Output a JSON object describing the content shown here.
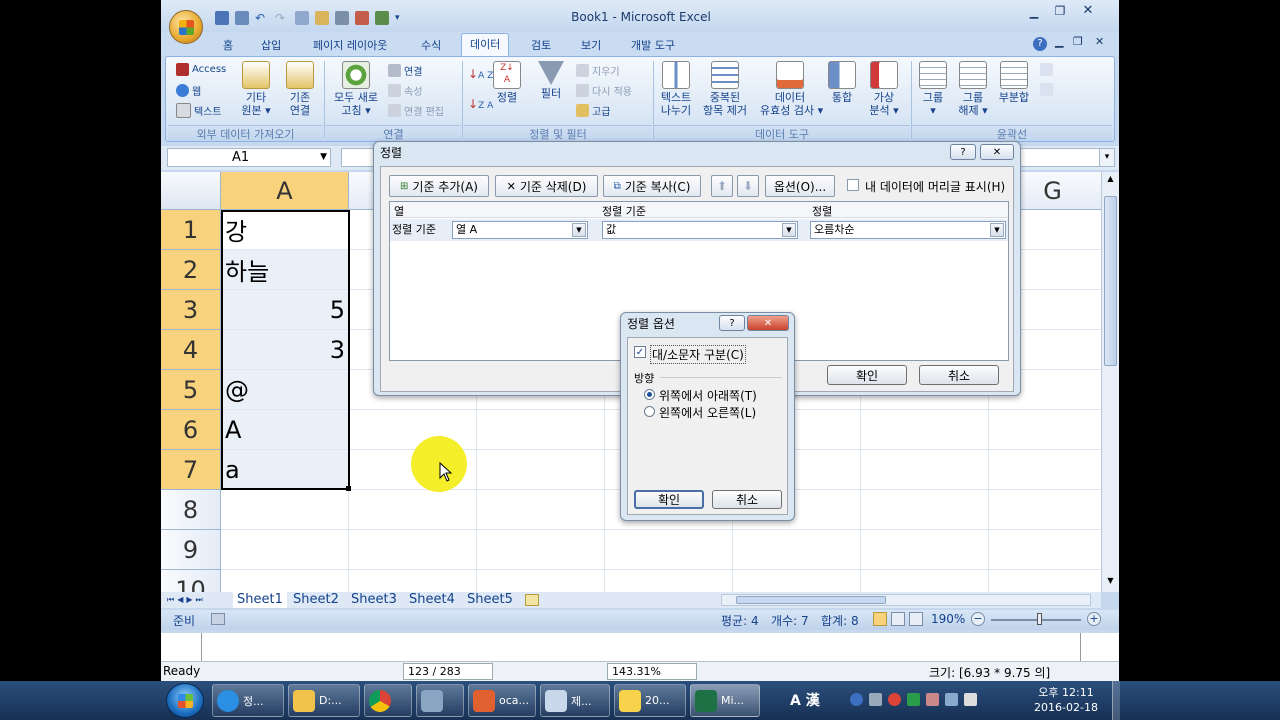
{
  "excel": {
    "title": "Book1 - Microsoft Excel",
    "tabs": [
      "홈",
      "삽입",
      "페이지 레이아웃",
      "수식",
      "데이터",
      "검토",
      "보기",
      "개발 도구"
    ],
    "active_tab": "데이터",
    "ribbon": {
      "external": {
        "access": "Access",
        "web": "웹",
        "text": "텍스트",
        "other": "기타\n원본 ▾",
        "existing": "기존\n연결",
        "group": "외부 데이터 가져오기"
      },
      "connections": {
        "refresh_all": "모두 새로\n고침 ▾",
        "connections": "연결",
        "properties": "속성",
        "edit_links": "연결 편집",
        "group": "연결"
      },
      "sort_filter": {
        "sort": "정렬",
        "filter": "필터",
        "clear": "지우기",
        "reapply": "다시 적용",
        "advanced": "고급",
        "group": "정렬 및 필터"
      },
      "data_tools": {
        "text_to_columns": "텍스트\n나누기",
        "remove_duplicates": "중복된\n항목 제거",
        "validation": "데이터\n유효성 검사 ▾",
        "consolidate": "통합",
        "what_if": "가상\n분석 ▾",
        "group": "데이터 도구"
      },
      "outline": {
        "group_btn": "그룹\n▾",
        "ungroup": "그룹\n해제 ▾",
        "subtotal": "부분합",
        "group": "윤곽선"
      }
    },
    "name_box": "A1",
    "columns": [
      "A",
      "G"
    ],
    "rows": [
      "1",
      "2",
      "3",
      "4",
      "5",
      "6",
      "7",
      "8",
      "9",
      "10"
    ],
    "cells": [
      "강",
      "하늘",
      "5",
      "3",
      "@",
      "A",
      "a"
    ],
    "sheets": [
      "Sheet1",
      "Sheet2",
      "Sheet3",
      "Sheet4",
      "Sheet5"
    ],
    "status": {
      "ready": "준비",
      "average": "평균: 4",
      "count": "개수: 7",
      "sum": "합계: 8",
      "zoom": "190%"
    }
  },
  "sort_dialog": {
    "title": "정렬",
    "add_level": "기준 추가(A)",
    "delete_level": "기준 삭제(D)",
    "copy_level": "기준 복사(C)",
    "options": "옵션(O)...",
    "headers_checkbox": "내 데이터에 머리글 표시(H)",
    "col_header": "열",
    "sort_on_header": "정렬 기준",
    "order_header": "정렬",
    "row_label": "정렬 기준",
    "column_value": "열 A",
    "sort_on_value": "값",
    "order_value": "오름차순",
    "ok": "확인",
    "cancel": "취소"
  },
  "sort_options_dialog": {
    "title": "정렬 옵션",
    "case_sensitive": "대/소문자 구분(C)",
    "orientation_label": "방향",
    "top_to_bottom": "위쪽에서 아래쪽(T)",
    "left_to_right": "왼쪽에서 오른쪽(L)",
    "ok": "확인",
    "cancel": "취소"
  },
  "background_app": {
    "ready": "Ready",
    "page": "123 / 283",
    "zoom": "143.31%",
    "size": "크기: [6.93 * 9.75 의]"
  },
  "taskbar": {
    "items": [
      "정...",
      "D:...",
      "",
      "",
      "oca...",
      "제...",
      "20...",
      "Mi..."
    ],
    "time": "오후 12:11",
    "date": "2016-02-18",
    "ime": "A 漢"
  }
}
